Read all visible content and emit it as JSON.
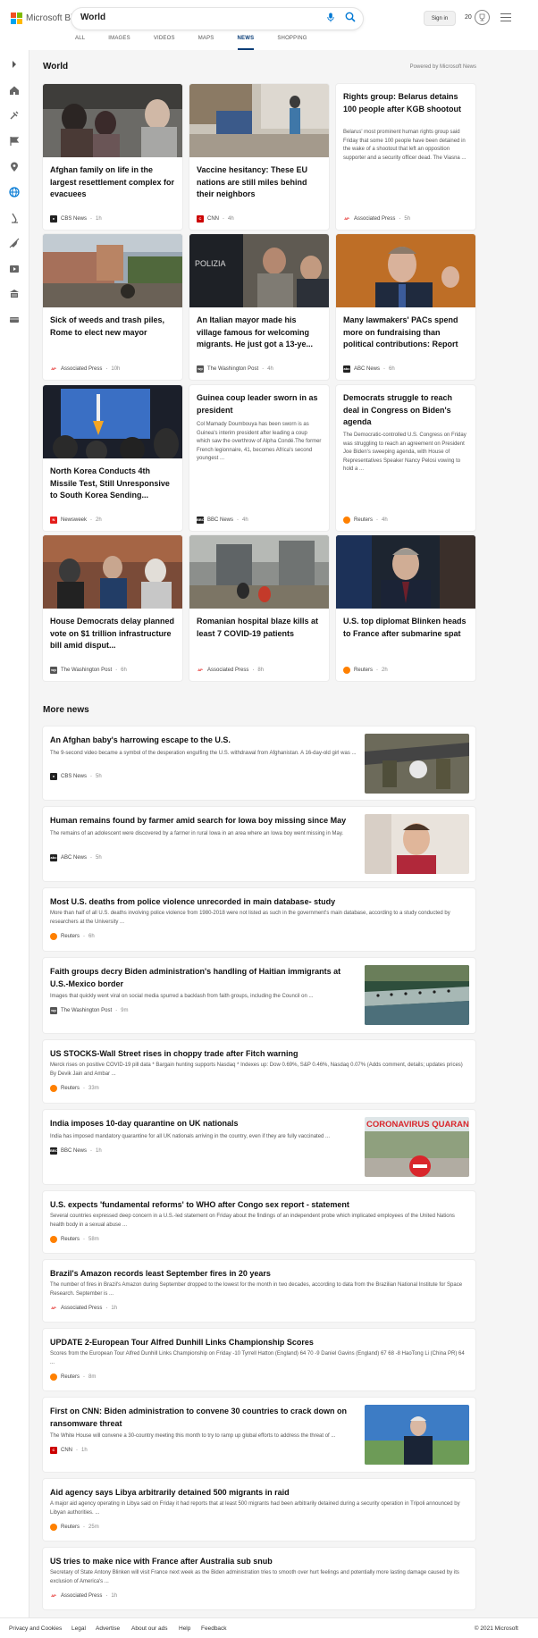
{
  "brand": {
    "logo_text": "Microsoft Bing",
    "logo_colors": [
      "#f25022",
      "#7fba00",
      "#00a4ef",
      "#ffb900"
    ]
  },
  "search": {
    "query": "World"
  },
  "header": {
    "sign_in_label": "Sign in",
    "rewards_points": "20"
  },
  "nav_tabs": [
    "ALL",
    "IMAGES",
    "VIDEOS",
    "MAPS",
    "NEWS",
    "SHOPPING"
  ],
  "active_tab": "NEWS",
  "section": {
    "title": "World",
    "powered_by": "Powered by Microsoft News"
  },
  "cards": [
    {
      "title": "Afghan family on life in the largest resettlement complex for evacuees",
      "source": "CBS News",
      "source_icon": "cbs-logo",
      "time": "1h"
    },
    {
      "title": "Vaccine hesitancy: These EU nations are still miles behind their neighbors",
      "source": "CNN",
      "source_icon": "cnn-logo",
      "time": "4h"
    },
    {
      "title": "Rights group: Belarus detains 100 people after KGB shootout",
      "snippet": "Belarus' most prominent human rights group said Friday that some 100 people have been detained in the wake of a shootout that left an opposition supporter and a security officer dead. The Viasna ...",
      "source": "Associated Press",
      "source_icon": "ap-logo",
      "time": "5h"
    },
    {
      "title": "Sick of weeds and trash piles, Rome to elect new mayor",
      "source": "Associated Press",
      "source_icon": "ap-logo",
      "time": "10h"
    },
    {
      "title": "An Italian mayor made his village famous for welcoming migrants. He just got a 13-ye...",
      "source": "The Washington Post",
      "source_icon": "wapo-logo",
      "time": "4h"
    },
    {
      "title": "Many lawmakers' PACs spend more on fundraising than political contributions: Report",
      "source": "ABC News",
      "source_icon": "abc-logo",
      "time": "6h"
    },
    {
      "title": "North Korea Conducts 4th Missile Test, Still Unresponsive to South Korea Sending...",
      "source": "Newsweek",
      "source_icon": "newsweek-logo",
      "time": "2h"
    },
    {
      "title": "Guinea coup leader sworn in as president",
      "snippet": "Col Mamady Doumbouya has been sworn is as Guinea's interim president after leading a coup which saw the overthrow of Alpha Condé.The former French legionnaire, 41, becomes Africa's second youngest ...",
      "source": "BBC News",
      "source_icon": "bbc-logo",
      "time": "4h"
    },
    {
      "title": "Democrats struggle to reach deal in Congress on Biden's agenda",
      "snippet": "The Democratic-controlled U.S. Congress on Friday was struggling to reach an agreement on President Joe Biden's sweeping agenda, with House of Representatives Speaker Nancy Pelosi vowing to hold a ...",
      "source": "Reuters",
      "source_icon": "reuters-logo",
      "time": "4h"
    },
    {
      "title": "House Democrats delay planned vote on $1 trillion infrastructure bill amid disput...",
      "source": "The Washington Post",
      "source_icon": "wapo-logo",
      "time": "6h"
    },
    {
      "title": "Romanian hospital blaze kills at least 7 COVID-19 patients",
      "source": "Associated Press",
      "source_icon": "ap-logo",
      "time": "8h"
    },
    {
      "title": "U.S. top diplomat Blinken heads to France after submarine spat",
      "source": "Reuters",
      "source_icon": "reuters-logo",
      "time": "2h"
    }
  ],
  "more_news": {
    "title": "More news",
    "items": [
      {
        "title": "An Afghan baby's harrowing escape to the U.S.",
        "snippet": "The 9-second video became a symbol of the desperation engulfing the U.S. withdrawal from Afghanistan. A 16-day-old girl was ...",
        "source": "CBS News",
        "source_icon": "cbs-logo",
        "time": "5h"
      },
      {
        "title": "Human remains found by farmer amid search for Iowa boy missing since May",
        "snippet": "The remains of an adolescent were discovered by a farmer in rural Iowa in an area where an Iowa boy went missing in May.",
        "source": "ABC News",
        "source_icon": "abc-logo",
        "time": "5h"
      },
      {
        "title": "Most U.S. deaths from police violence unrecorded in main database- study",
        "snippet": "More than half of all U.S. deaths involving police violence from 1980-2018 were not listed as such in the government's main database, according to a study conducted by researchers at the University ...",
        "source": "Reuters",
        "source_icon": "reuters-logo",
        "time": "6h"
      },
      {
        "title": "Faith groups decry Biden administration's handling of Haitian immigrants at U.S.-Mexico border",
        "snippet": "Images that quickly went viral on social media spurred a backlash from faith groups, including the Council on ...",
        "source": "The Washington Post",
        "source_icon": "wapo-logo",
        "time": "9m"
      },
      {
        "title": "US STOCKS-Wall Street rises in choppy trade after Fitch warning",
        "snippet": "Merck rises on positive COVID-19 pill data * Bargain hunting supports Nasdaq * Indexes up: Dow 0.69%, S&P 0.46%, Nasdaq 0.07% (Adds comment, details; updates prices) By Devik Jain and Ambar ...",
        "source": "Reuters",
        "source_icon": "reuters-logo",
        "time": "33m"
      },
      {
        "title": "India imposes 10-day quarantine on UK nationals",
        "snippet": "India has imposed mandatory quarantine for all UK nationals arriving in the country, even if they are fully vaccinated ...",
        "source": "BBC News",
        "source_icon": "bbc-logo",
        "time": "1h",
        "image_caption": "CORONAVIRUS QUARANTIN"
      },
      {
        "title": "U.S. expects 'fundamental reforms' to WHO after Congo sex report - statement",
        "snippet": "Several countries expressed deep concern in a U.S.-led statement on Friday about the findings of an independent probe which implicated employees of the United Nations health body in a sexual abuse ...",
        "source": "Reuters",
        "source_icon": "reuters-logo",
        "time": "58m"
      },
      {
        "title": "Brazil's Amazon records least September fires in 20 years",
        "snippet": "The number of fires in Brazil's Amazon during September dropped to the lowest for the month in two decades, according to data from the Brazilian National Institute for Space Research. September is ...",
        "source": "Associated Press",
        "source_icon": "ap-logo",
        "time": "1h"
      },
      {
        "title": "UPDATE 2-European Tour Alfred Dunhill Links Championship Scores",
        "snippet": "Scores from the European Tour Alfred Dunhill Links Championship on Friday -10 Tyrrell Hatton (England) 64 70 -9 Daniel Gavins (England) 67 68 -8 HaoTong Li (China PR) 64 ...",
        "source": "Reuters",
        "source_icon": "reuters-logo",
        "time": "8m"
      },
      {
        "title": "First on CNN: Biden administration to convene 30 countries to crack down on ransomware threat",
        "snippet": "The White House will convene a 30-country meeting this month to try to ramp up global efforts to address the threat of ...",
        "source": "CNN",
        "source_icon": "cnn-logo",
        "time": "1h"
      },
      {
        "title": "Aid agency says Libya arbitrarily detained 500 migrants in raid",
        "snippet": "A major aid agency operating in Libya said on Friday it had reports that at least 500 migrants had been arbitrarily detained during a security operation in Tripoli announced by Libyan authorities. ...",
        "source": "Reuters",
        "source_icon": "reuters-logo",
        "time": "25m"
      },
      {
        "title": "US tries to make nice with France after Australia sub snub",
        "snippet": "Secretary of State Antony Blinken will visit France next week as the Biden administration tries to smooth over hurt feelings and potentially more lasting damage caused by its exclusion of America's ...",
        "source": "Associated Press",
        "source_icon": "ap-logo",
        "time": "1h"
      }
    ]
  },
  "footer": {
    "links": [
      "Privacy and Cookies",
      "Legal",
      "Advertise",
      "About our ads",
      "Help",
      "Feedback"
    ],
    "copyright": "© 2021 Microsoft"
  },
  "sidebar_icons": [
    "chevron-right-icon",
    "home-icon",
    "tools-icon",
    "flag-icon",
    "map-pin-icon",
    "globe-icon",
    "microscope-icon",
    "rocket-icon",
    "video-icon",
    "building-icon",
    "card-icon"
  ],
  "colors": {
    "accent": "#0a3d77",
    "brand_blue": "#0078d4"
  }
}
